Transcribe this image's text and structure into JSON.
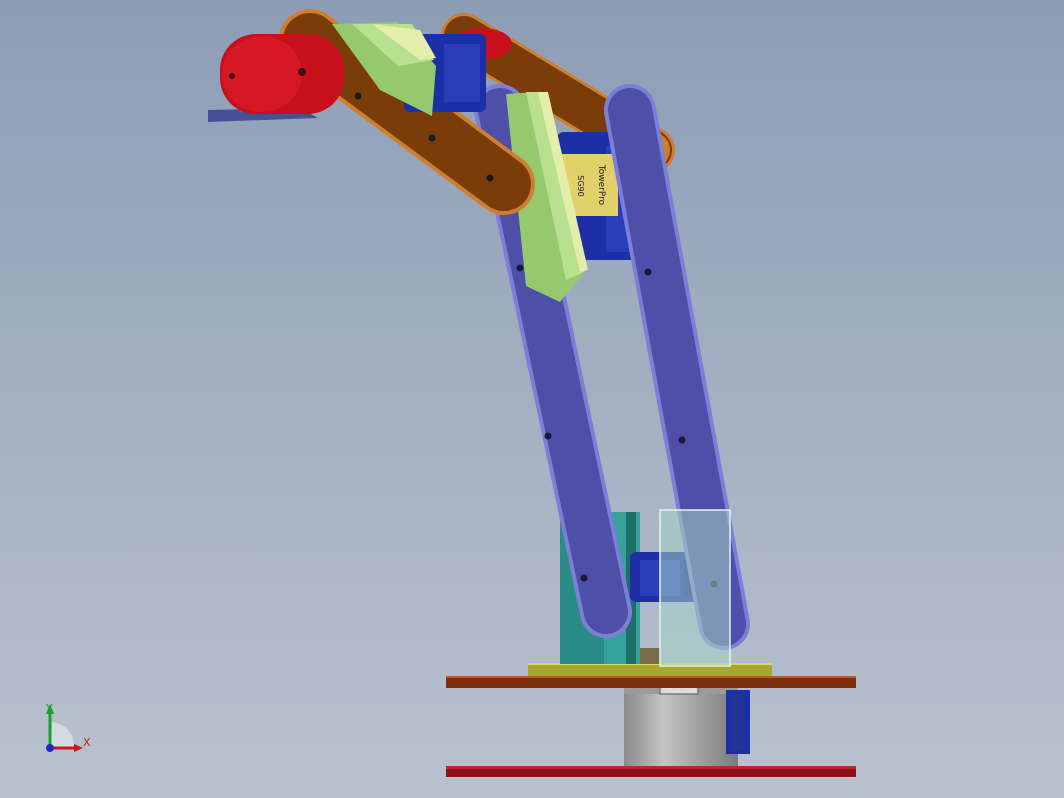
{
  "viewport": {
    "background_top": "#8c9db5",
    "background_bottom": "#b9c3cf"
  },
  "parts": {
    "upper_arm_color": "#7a3c08",
    "upper_arm_edge": "#cf7e2e",
    "forearm_color": "#4d4fa8",
    "forearm_edge": "#7d7fd6",
    "horn_color": "#c7101c",
    "spacer_colors": [
      "#96c86e",
      "#b8e08e",
      "#e4eeaa"
    ],
    "servo_color": "#1c2fa6",
    "servo_label_color": "#e2d06a",
    "bracket_teal": "#2a8c86",
    "bracket_glass": "#a6d2c4",
    "base_plate_color": "#7c3010",
    "bottom_plate_color": "#8c1016",
    "pcb_color": "#a8a830",
    "motor_color": "#a2a2a2",
    "gripper_plate_color": "#4a4e98"
  },
  "triad": {
    "x_label": "X",
    "y_label": "Y",
    "x_color": "#c81a1a",
    "y_color": "#1aa02a",
    "z_color": "#1a2ac8"
  }
}
